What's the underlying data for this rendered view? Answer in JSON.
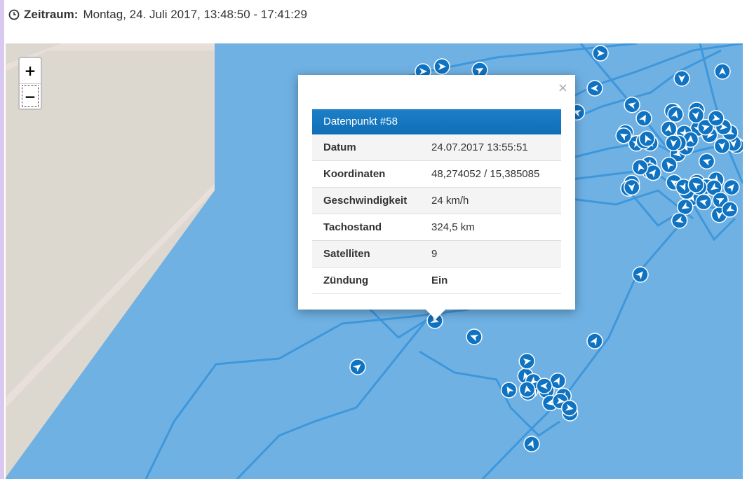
{
  "header": {
    "label": "Zeitraum:",
    "value": "Montag, 24. Juli 2017, 13:48:50 - 17:41:29"
  },
  "zoom": {
    "in_label": "+",
    "out_label": "−"
  },
  "popup": {
    "close_label": "×",
    "title": "Datenpunkt #58",
    "rows": [
      {
        "key": "Datum",
        "value": "24.07.2017 13:55:51"
      },
      {
        "key": "Koordinaten",
        "value": "48,274052 / 15,385085"
      },
      {
        "key": "Geschwindigkeit",
        "value": "24 km/h"
      },
      {
        "key": "Tachostand",
        "value": "324,5 km"
      },
      {
        "key": "Satelliten",
        "value": "9"
      },
      {
        "key": "Zündung",
        "value": "Ein"
      }
    ]
  },
  "colors": {
    "water": "#6fb1e3",
    "land": "#ddd8cf",
    "shore": "#e8dfda",
    "track": "#3f97db",
    "marker": "#0f73c2",
    "popup_header": "#1577c0"
  }
}
